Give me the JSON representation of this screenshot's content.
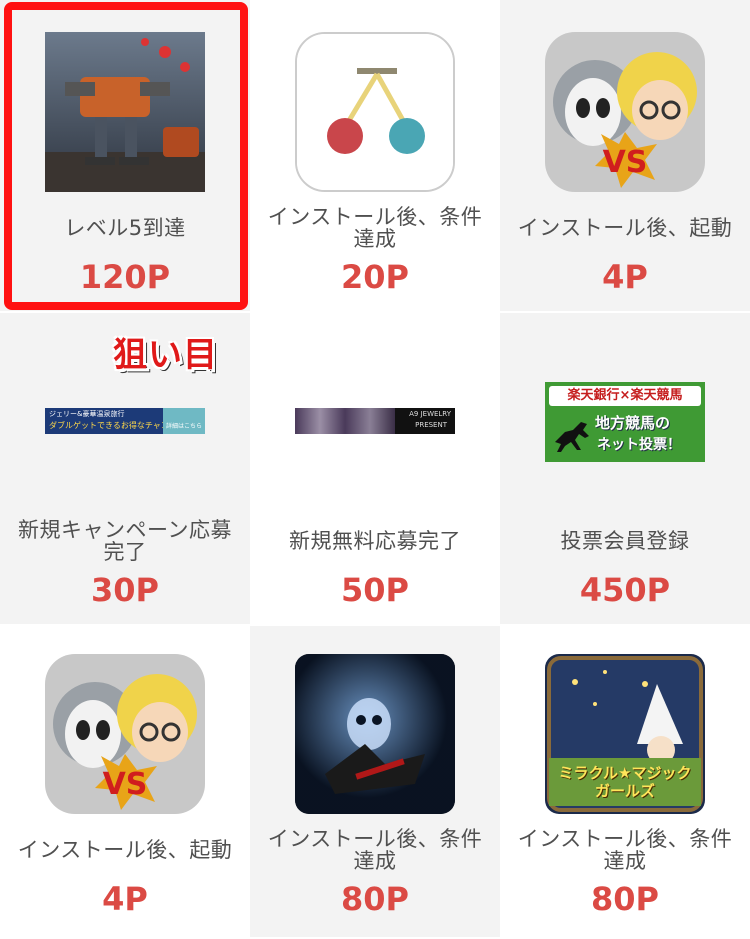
{
  "offers": [
    {
      "condition": "レベル5到達",
      "points": "120P"
    },
    {
      "condition": "インストール後、条件達成",
      "points": "20P"
    },
    {
      "condition": "インストール後、起動",
      "points": "4P"
    },
    {
      "condition": "新規キャンペーン応募完了",
      "points": "30P",
      "banner_text_line1": "ジェリー&豪華温泉旅行",
      "banner_text_line2": "ダブルゲットできるお得なチャンス",
      "banner_button": "詳細はこちら"
    },
    {
      "condition": "新規無料応募完了",
      "points": "50P",
      "banner_text": "A9 JEWELRY",
      "banner_text2": "PRESENT"
    },
    {
      "condition": "投票会員登録",
      "points": "450P",
      "banner_line1": "楽天銀行×楽天競馬",
      "banner_line2": "地方競馬の",
      "banner_line3": "ネット投票！"
    },
    {
      "condition": "インストール後、起動",
      "points": "4P"
    },
    {
      "condition": "インストール後、条件達成",
      "points": "80P"
    },
    {
      "condition": "インストール後、条件達成",
      "points": "80P",
      "icon_text": "ミラクル★マジックガールズ"
    }
  ],
  "annotation": "狙い目",
  "colors": {
    "points": "#db4a44",
    "highlight": "#ff1111",
    "cell_gray": "#f3f3f3"
  }
}
